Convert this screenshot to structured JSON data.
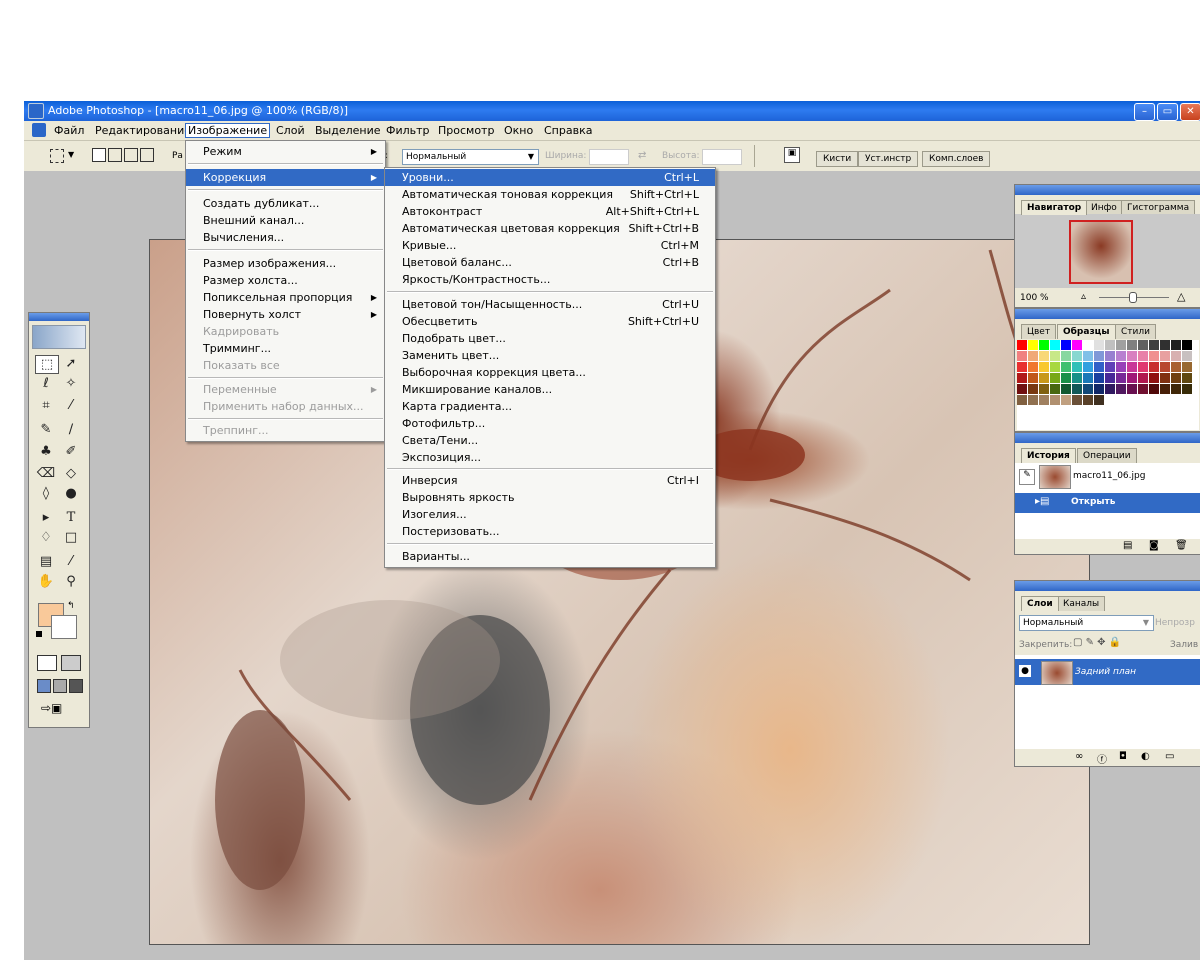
{
  "window": {
    "title": "Adobe Photoshop - [macro11_06.jpg @ 100% (RGB/8)]",
    "minimize_label": "–",
    "restore_label": "▭",
    "close_label": "✕"
  },
  "menubar": {
    "items": [
      "Файл",
      "Редактирование",
      "Изображение",
      "Слой",
      "Выделение",
      "Фильтр",
      "Просмотр",
      "Окно",
      "Справка"
    ]
  },
  "options": {
    "style_label_partial": "Ра",
    "mode_label": "л:",
    "mode_value": "Нормальный",
    "width_label": "Ширина:",
    "height_label": "Высота:",
    "palette_tabs": [
      "Кисти",
      "Уст.инстр",
      "Комп.слоев"
    ]
  },
  "image_menu": {
    "items": [
      {
        "label": "Режим",
        "submenu": true
      },
      {
        "label": "Коррекция",
        "submenu": true,
        "highlight": true
      },
      {
        "label": "Создать дубликат..."
      },
      {
        "label": "Внешний канал..."
      },
      {
        "label": "Вычисления..."
      },
      {
        "label": "Размер изображения..."
      },
      {
        "label": "Размер холста..."
      },
      {
        "label": "Попиксельная пропорция",
        "submenu": true
      },
      {
        "label": "Повернуть холст",
        "submenu": true
      },
      {
        "label": "Кадрировать",
        "disabled": true
      },
      {
        "label": "Тримминг..."
      },
      {
        "label": "Показать все",
        "disabled": true
      },
      {
        "label": "Переменные",
        "disabled": true,
        "submenu": true
      },
      {
        "label": "Применить набор данных...",
        "disabled": true
      },
      {
        "label": "Треппинг...",
        "disabled": true
      }
    ]
  },
  "adjust_menu": {
    "items": [
      {
        "label": "Уровни...",
        "shortcut": "Ctrl+L",
        "highlight": true
      },
      {
        "label": "Автоматическая тоновая коррекция",
        "shortcut": "Shift+Ctrl+L"
      },
      {
        "label": "Автоконтраст",
        "shortcut": "Alt+Shift+Ctrl+L"
      },
      {
        "label": "Автоматическая цветовая коррекция",
        "shortcut": "Shift+Ctrl+B"
      },
      {
        "label": "Кривые...",
        "shortcut": "Ctrl+M"
      },
      {
        "label": "Цветовой баланс...",
        "shortcut": "Ctrl+B"
      },
      {
        "label": "Яркость/Контрастность..."
      },
      {
        "label": "Цветовой тон/Насыщенность...",
        "shortcut": "Ctrl+U"
      },
      {
        "label": "Обесцветить",
        "shortcut": "Shift+Ctrl+U"
      },
      {
        "label": "Подобрать цвет..."
      },
      {
        "label": "Заменить цвет..."
      },
      {
        "label": "Выборочная коррекция цвета..."
      },
      {
        "label": "Микширование каналов..."
      },
      {
        "label": "Карта градиента..."
      },
      {
        "label": "Фотофильтр..."
      },
      {
        "label": "Света/Тени..."
      },
      {
        "label": "Экспозиция..."
      },
      {
        "label": "Инверсия",
        "shortcut": "Ctrl+I"
      },
      {
        "label": "Выровнять яркость"
      },
      {
        "label": "Изогелия..."
      },
      {
        "label": "Постеризовать..."
      },
      {
        "label": "Варианты..."
      }
    ]
  },
  "navigator_panel": {
    "tabs": [
      "Навигатор",
      "Инфо",
      "Гистограмма"
    ],
    "zoom": "100 %"
  },
  "swatches_panel": {
    "tabs": [
      "Цвет",
      "Образцы",
      "Стили"
    ]
  },
  "history_panel": {
    "tabs": [
      "История",
      "Операции"
    ],
    "snapshot_name": "macro11_06.jpg",
    "step_name": "Открыть"
  },
  "layers_panel": {
    "tabs": [
      "Слои",
      "Каналы"
    ],
    "blend_mode": "Нормальный",
    "opacity_label": "Непрозр",
    "lock_label": "Закрепить:",
    "fill_label": "Залив",
    "layer_name": "Задний план"
  },
  "colors": {
    "foreground": "#f9c99a",
    "background": "#ffffff",
    "highlight": "#316ac5",
    "title_bar": "#0a5fd8"
  }
}
